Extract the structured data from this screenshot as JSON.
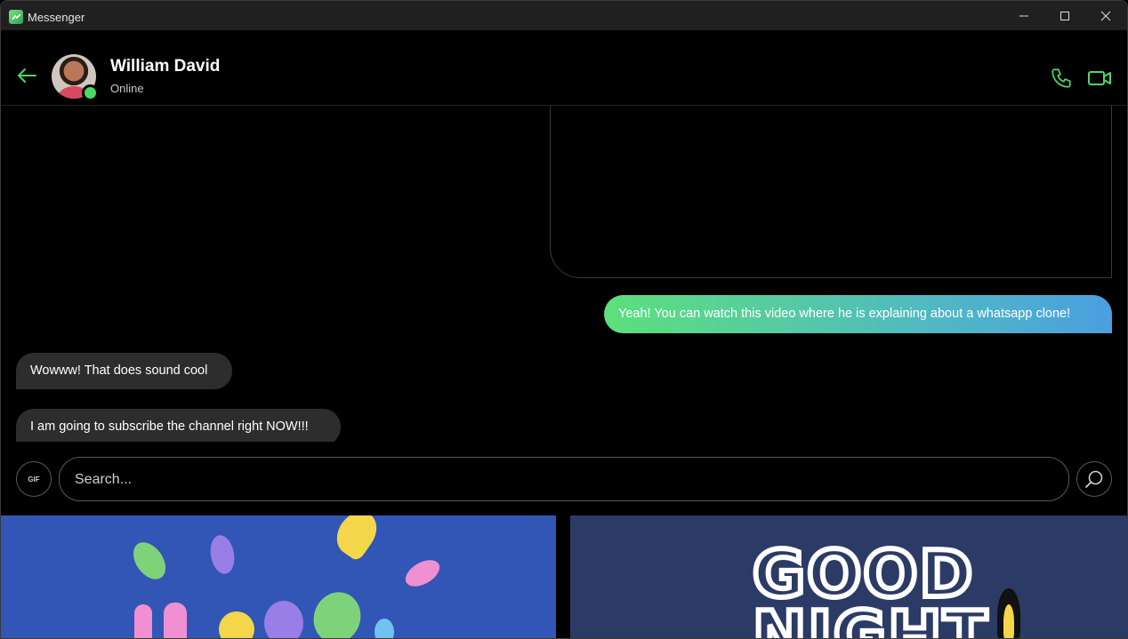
{
  "window": {
    "title": "Messenger",
    "icon": "messenger-icon"
  },
  "window_controls": {
    "minimize": "minimize-icon",
    "maximize": "maximize-icon",
    "close": "close-icon"
  },
  "header": {
    "back_icon": "arrow-left-icon",
    "contact_name": "William David",
    "status": "Online",
    "call_icon": "phone-icon",
    "video_icon": "video-camera-icon",
    "accent_color": "#4cd964"
  },
  "messages": [
    {
      "direction": "outgoing",
      "text": "Yeah! You can watch this video where he is explaining about a whatsapp clone!"
    },
    {
      "direction": "incoming",
      "text": "Wowww! That does sound cool"
    },
    {
      "direction": "incoming",
      "text": "I am going to subscribe the channel right NOW!!!"
    }
  ],
  "composer": {
    "gif_label": "GIF",
    "search_placeholder": "Search...",
    "search_value": "",
    "search_icon": "magnifier-icon"
  },
  "gif_results": [
    {
      "id": "gif-1",
      "background": "#3156b6"
    },
    {
      "id": "gif-2",
      "background": "#2c3a66",
      "text": "GOOD NIGHT"
    }
  ]
}
